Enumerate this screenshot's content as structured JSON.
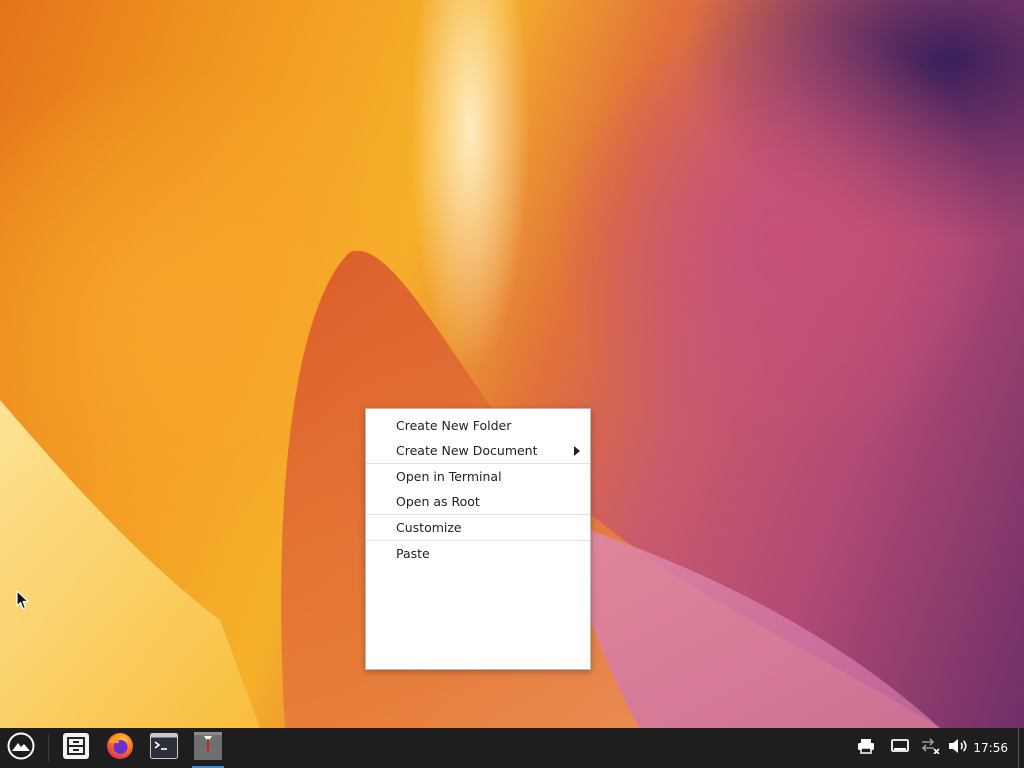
{
  "context_menu": {
    "items": [
      {
        "label": "Create New Folder"
      },
      {
        "label": "Create New Document",
        "has_submenu": true
      },
      {
        "label": "Open in Terminal"
      },
      {
        "label": "Open as Root"
      },
      {
        "label": "Customize"
      },
      {
        "label": "Paste"
      }
    ]
  },
  "taskbar": {
    "start_icon": "zorin-logo-icon",
    "pinned": [
      {
        "icon": "file-manager-icon"
      },
      {
        "icon": "firefox-icon"
      },
      {
        "icon": "terminal-icon"
      },
      {
        "icon": "app-window-icon",
        "active": true
      }
    ],
    "tray": [
      {
        "icon": "printer-icon"
      },
      {
        "icon": "display-icon"
      },
      {
        "icon": "network-disconnected-icon"
      },
      {
        "icon": "volume-icon"
      }
    ],
    "clock": "17:56"
  },
  "colors": {
    "taskbar_bg": "#1e1e1e",
    "menu_bg": "#ffffff",
    "active_indicator": "#3d8fd8"
  }
}
